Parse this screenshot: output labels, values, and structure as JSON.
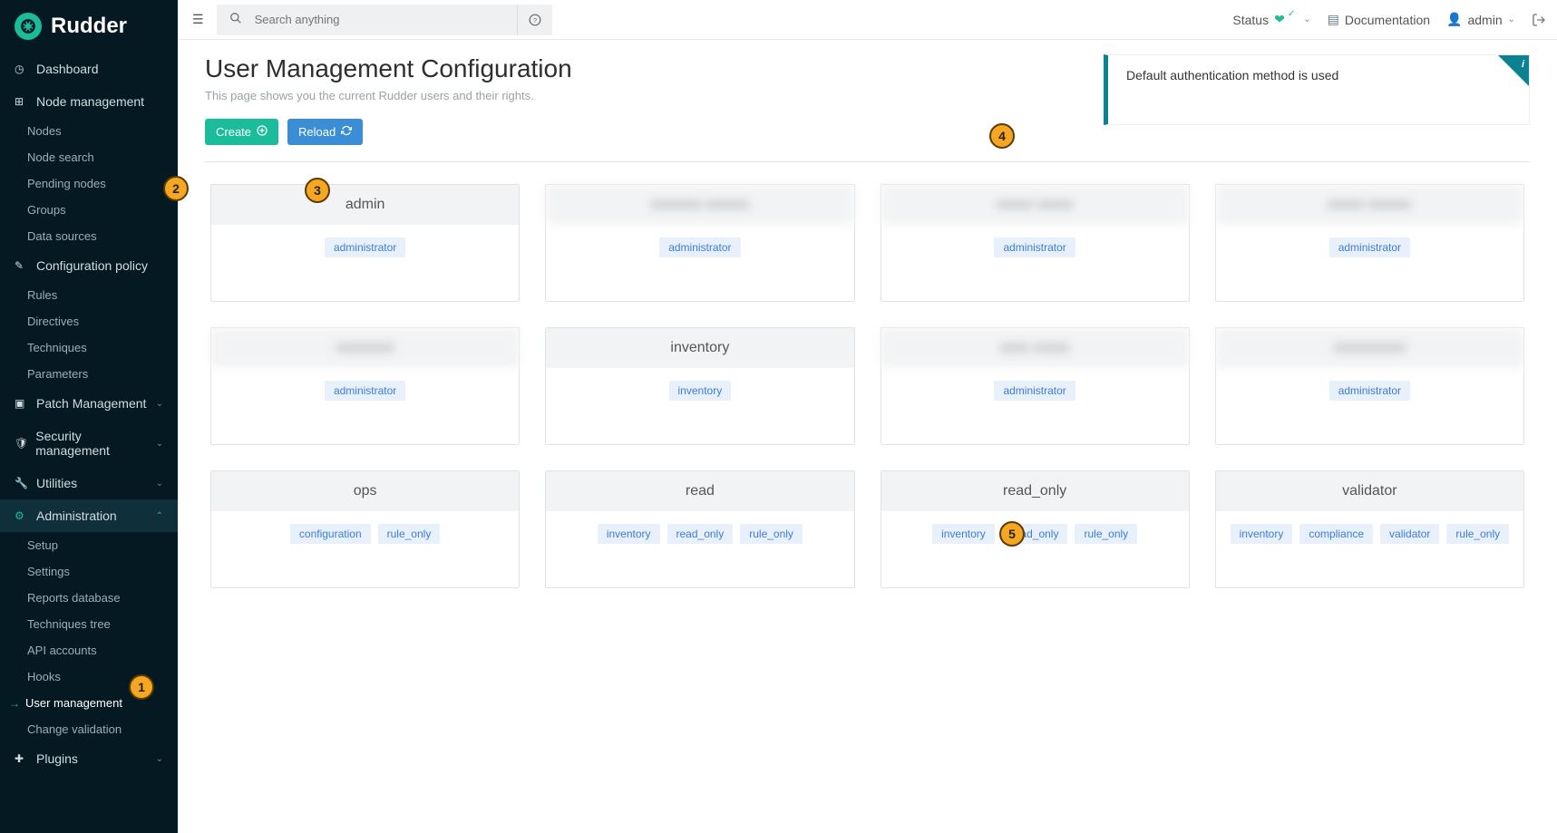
{
  "brand": "Rudder",
  "topbar": {
    "search_placeholder": "Search anything",
    "status_label": "Status",
    "documentation_label": "Documentation",
    "user_label": "admin"
  },
  "sidebar": {
    "dashboard": "Dashboard",
    "node_mgmt": {
      "label": "Node management",
      "items": [
        "Nodes",
        "Node search",
        "Pending nodes",
        "Groups",
        "Data sources"
      ]
    },
    "config_policy": {
      "label": "Configuration policy",
      "items": [
        "Rules",
        "Directives",
        "Techniques",
        "Parameters"
      ]
    },
    "patch_mgmt": "Patch Management",
    "security_mgmt": "Security management",
    "utilities": "Utilities",
    "administration": {
      "label": "Administration",
      "items": [
        "Setup",
        "Settings",
        "Reports database",
        "Techniques tree",
        "API accounts",
        "Hooks",
        "User management",
        "Change validation"
      ]
    },
    "plugins": "Plugins"
  },
  "page": {
    "title": "User Management Configuration",
    "subtitle": "This page shows you the current Rudder users and their rights.",
    "notice": "Default authentication method is used",
    "create_label": "Create",
    "reload_label": "Reload"
  },
  "callouts": [
    "1",
    "2",
    "3",
    "4",
    "5"
  ],
  "users": [
    {
      "name": "admin",
      "blurred": false,
      "roles": [
        "administrator"
      ]
    },
    {
      "name": "xxxxxxx xxxxxx",
      "blurred": true,
      "roles": [
        "administrator"
      ]
    },
    {
      "name": "xxxxx xxxxx",
      "blurred": true,
      "roles": [
        "administrator"
      ]
    },
    {
      "name": "xxxxx xxxxxx",
      "blurred": true,
      "roles": [
        "administrator"
      ]
    },
    {
      "name": "xxxxxxxx",
      "blurred": true,
      "roles": [
        "administrator"
      ]
    },
    {
      "name": "inventory",
      "blurred": false,
      "roles": [
        "inventory"
      ]
    },
    {
      "name": "xxxx xxxxx",
      "blurred": true,
      "roles": [
        "administrator"
      ]
    },
    {
      "name": "xxxxxxxxxx",
      "blurred": true,
      "roles": [
        "administrator"
      ]
    },
    {
      "name": "ops",
      "blurred": false,
      "roles": [
        "configuration",
        "rule_only"
      ]
    },
    {
      "name": "read",
      "blurred": false,
      "roles": [
        "inventory",
        "read_only",
        "rule_only"
      ]
    },
    {
      "name": "read_only",
      "blurred": false,
      "roles": [
        "inventory",
        "read_only",
        "rule_only"
      ]
    },
    {
      "name": "validator",
      "blurred": false,
      "roles": [
        "inventory",
        "compliance",
        "validator",
        "rule_only"
      ]
    }
  ]
}
